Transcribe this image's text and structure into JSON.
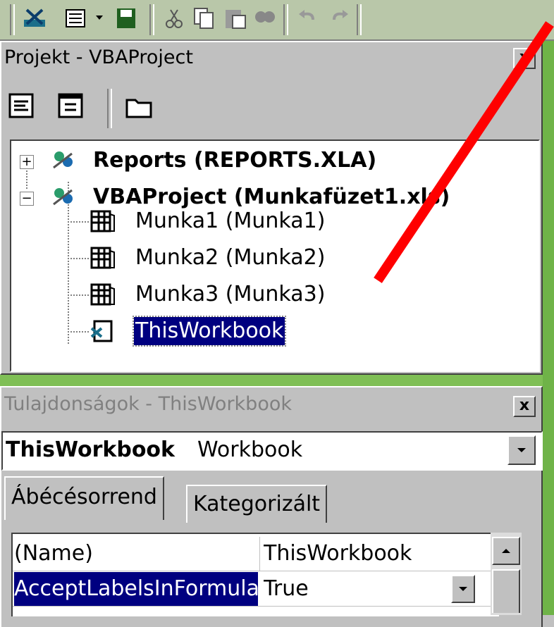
{
  "project_panel": {
    "title": "Projekt - VBAProject",
    "close_label": "x",
    "tree": [
      {
        "label": "Reports (REPORTS.XLA)",
        "expander": "+"
      },
      {
        "label": "VBAProject (Munkafüzet1.xls)",
        "expander": "−"
      },
      {
        "label": "Munka1 (Munka1)"
      },
      {
        "label": "Munka2 (Munka2)"
      },
      {
        "label": "Munka3 (Munka3)"
      },
      {
        "label": "ThisWorkbook"
      }
    ]
  },
  "properties_panel": {
    "title": "Tulajdonságok - ThisWorkbook",
    "close_label": "x",
    "object_name": "ThisWorkbook",
    "object_type": "Workbook",
    "tabs": [
      {
        "label": "Ábécésorrend"
      },
      {
        "label": "Kategorizált"
      }
    ],
    "rows": [
      {
        "name": "(Name)",
        "value": "ThisWorkbook"
      },
      {
        "name": "AcceptLabelsInFormula",
        "value": "True"
      }
    ]
  },
  "colors": {
    "selection": "#000080",
    "background": "#7fbf55",
    "annotation_line": "#ff0000"
  }
}
